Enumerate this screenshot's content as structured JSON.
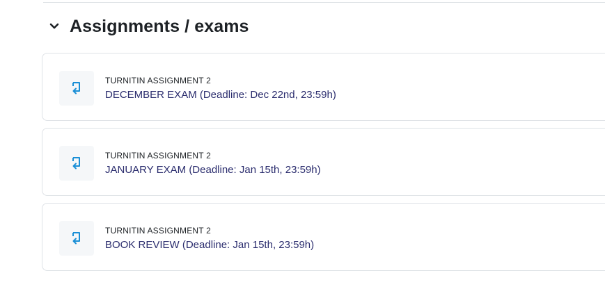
{
  "section": {
    "title": "Assignments / exams",
    "toggle_icon": "chevron-down-icon"
  },
  "activities": [
    {
      "type": "TURNITIN ASSIGNMENT 2",
      "name": "DECEMBER EXAM (Deadline: Dec 22nd, 23:59h)",
      "icon": "turnitin-icon"
    },
    {
      "type": "TURNITIN ASSIGNMENT 2",
      "name": "JANUARY EXAM (Deadline: Jan 15th, 23:59h)",
      "icon": "turnitin-icon"
    },
    {
      "type": "TURNITIN ASSIGNMENT 2",
      "name": "BOOK REVIEW (Deadline: Jan 15th, 23:59h)",
      "icon": "turnitin-icon"
    }
  ],
  "colors": {
    "title": "#1d2125",
    "link": "#2b2d6e",
    "icon_accent": "#1a8fd6",
    "card_border": "#dee2e6",
    "icon_bg": "#f5f7f9"
  }
}
